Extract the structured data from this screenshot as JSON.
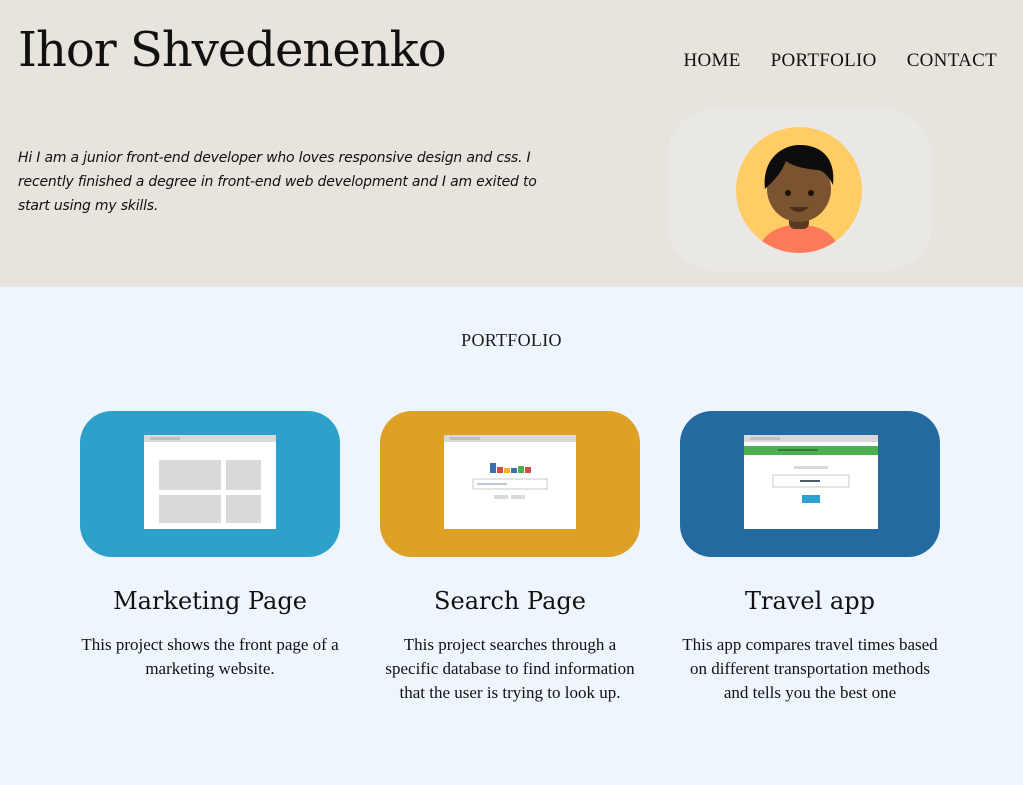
{
  "site": {
    "title": "Ihor Shvedenenko",
    "nav": [
      "HOME",
      "PORTFOLIO",
      "CONTACT"
    ],
    "intro": "Hi I am a junior front-end developer who loves responsive design and css. I recently finished a degree in front-end web development and I am exited to start using my skills."
  },
  "colors": {
    "hero_bg": "#e8e3dd",
    "page_bg": "#eef5fc",
    "avatar_frame": "#eae8e5",
    "avatar_circle": "#ffcc66",
    "card1": "#2ea1cb",
    "card2": "#dda125",
    "card3": "#236aa1"
  },
  "portfolio": {
    "heading": "PORTFOLIO",
    "cards": [
      {
        "title": "Marketing Page",
        "desc": "This project shows the front page of a marketing website.",
        "icon": "marketing-page-thumbnail"
      },
      {
        "title": "Search Page",
        "desc": "This project searches through a specific database to find information that the user is trying to look up.",
        "icon": "search-page-thumbnail"
      },
      {
        "title": "Travel app",
        "desc": "This app compares travel times based on different transportation methods and tells you the best one",
        "icon": "travel-app-thumbnail"
      }
    ]
  }
}
